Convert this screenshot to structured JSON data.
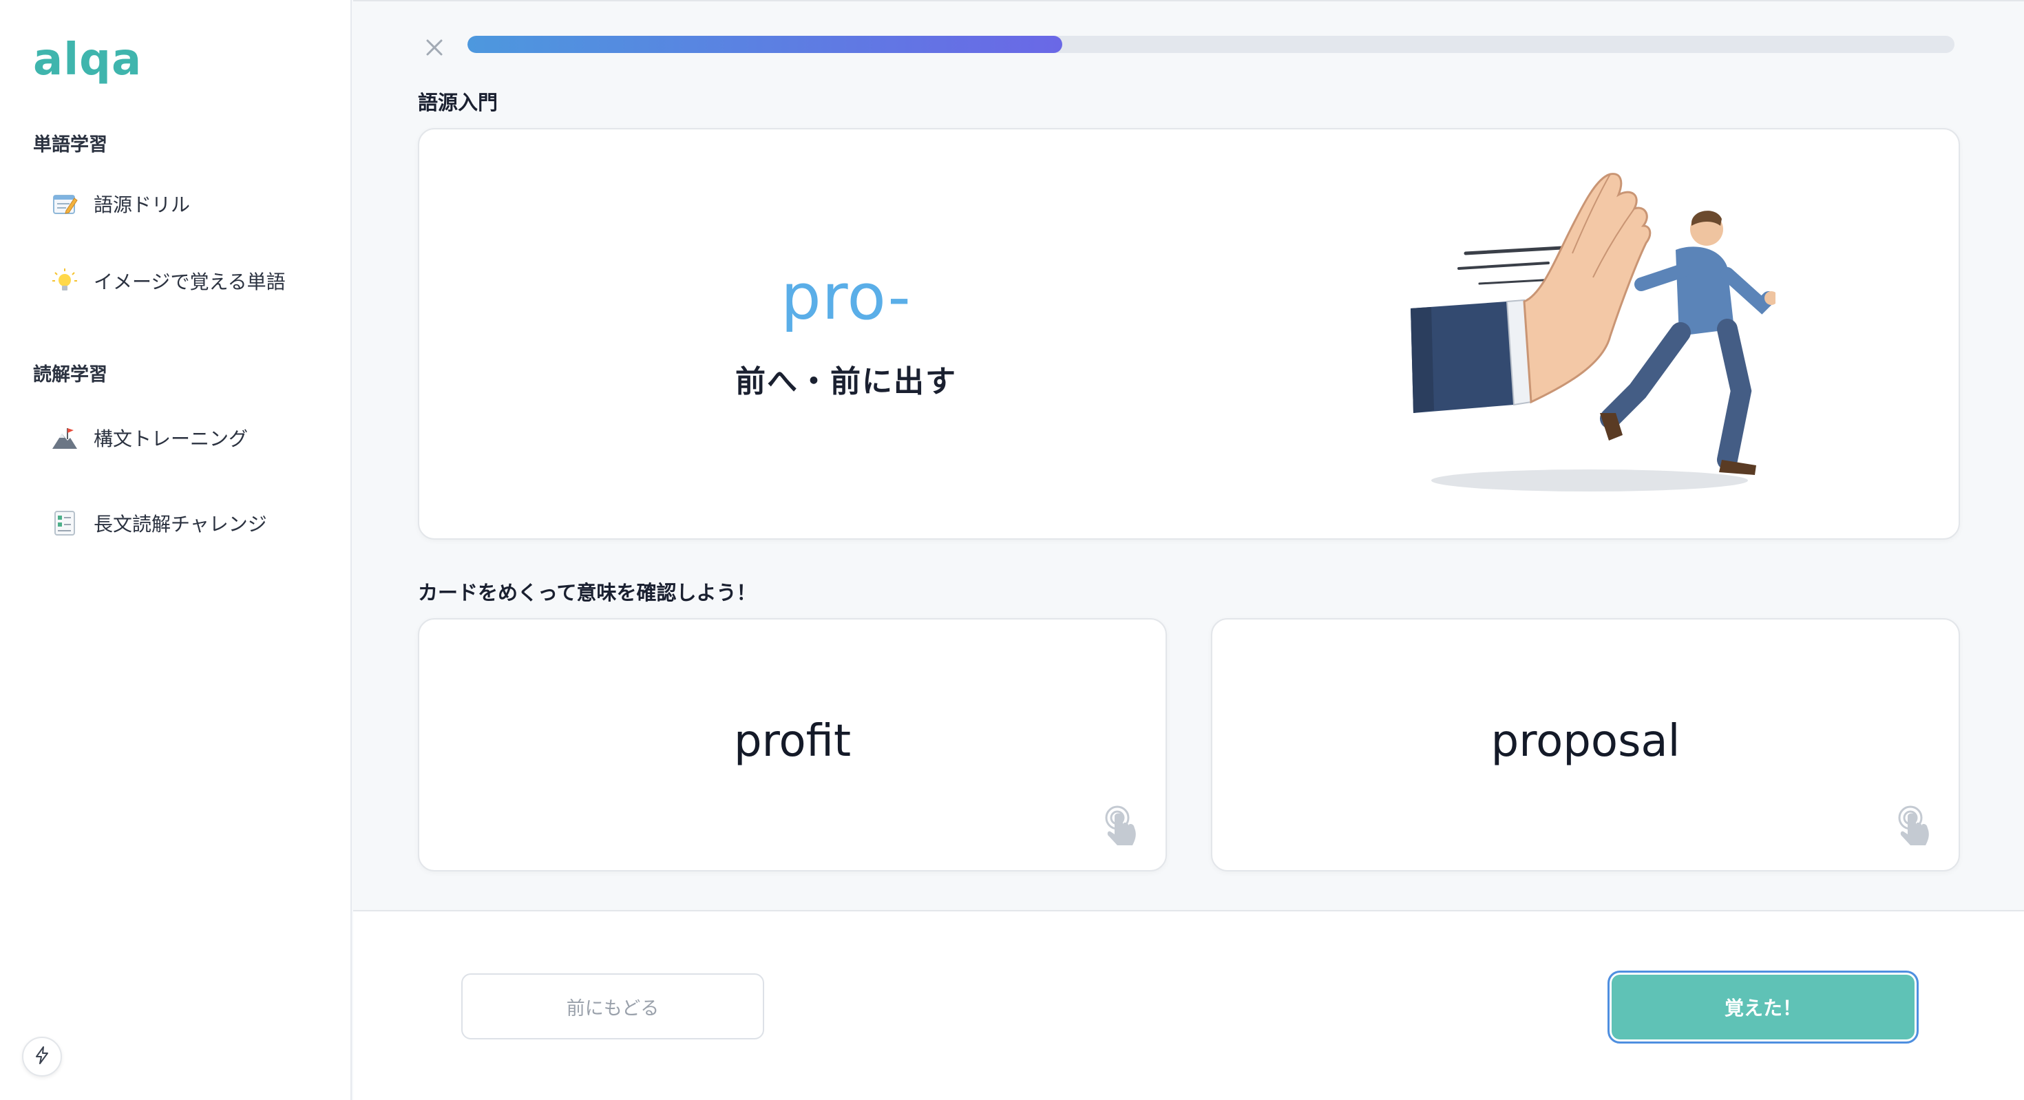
{
  "app": {
    "logo": "alqa"
  },
  "sidebar": {
    "sections": [
      {
        "title": "単語学習",
        "items": [
          {
            "label": "語源ドリル",
            "icon": "memo-icon"
          },
          {
            "label": "イメージで覚える単語",
            "icon": "lightbulb-icon"
          }
        ]
      },
      {
        "title": "読解学習",
        "items": [
          {
            "label": "構文トレーニング",
            "icon": "mountain-flag-icon"
          },
          {
            "label": "長文読解チャレンジ",
            "icon": "checklist-icon"
          }
        ]
      }
    ]
  },
  "lesson": {
    "progress": 0.4,
    "title": "語源入門",
    "prefix": "pro-",
    "meaning": "前へ・前に出す",
    "instruction": "カードをめくって意味を確認しよう！",
    "cards": [
      {
        "word": "profit"
      },
      {
        "word": "proposal"
      }
    ]
  },
  "footer": {
    "back_label": "前にもどる",
    "done_label": "覚えた！"
  },
  "colors": {
    "brand": "#3fb5ad",
    "prefix": "#5aaee8",
    "primary_button": "#5fc2b6",
    "progress_start": "#4d98de",
    "progress_end": "#6a68e6"
  }
}
